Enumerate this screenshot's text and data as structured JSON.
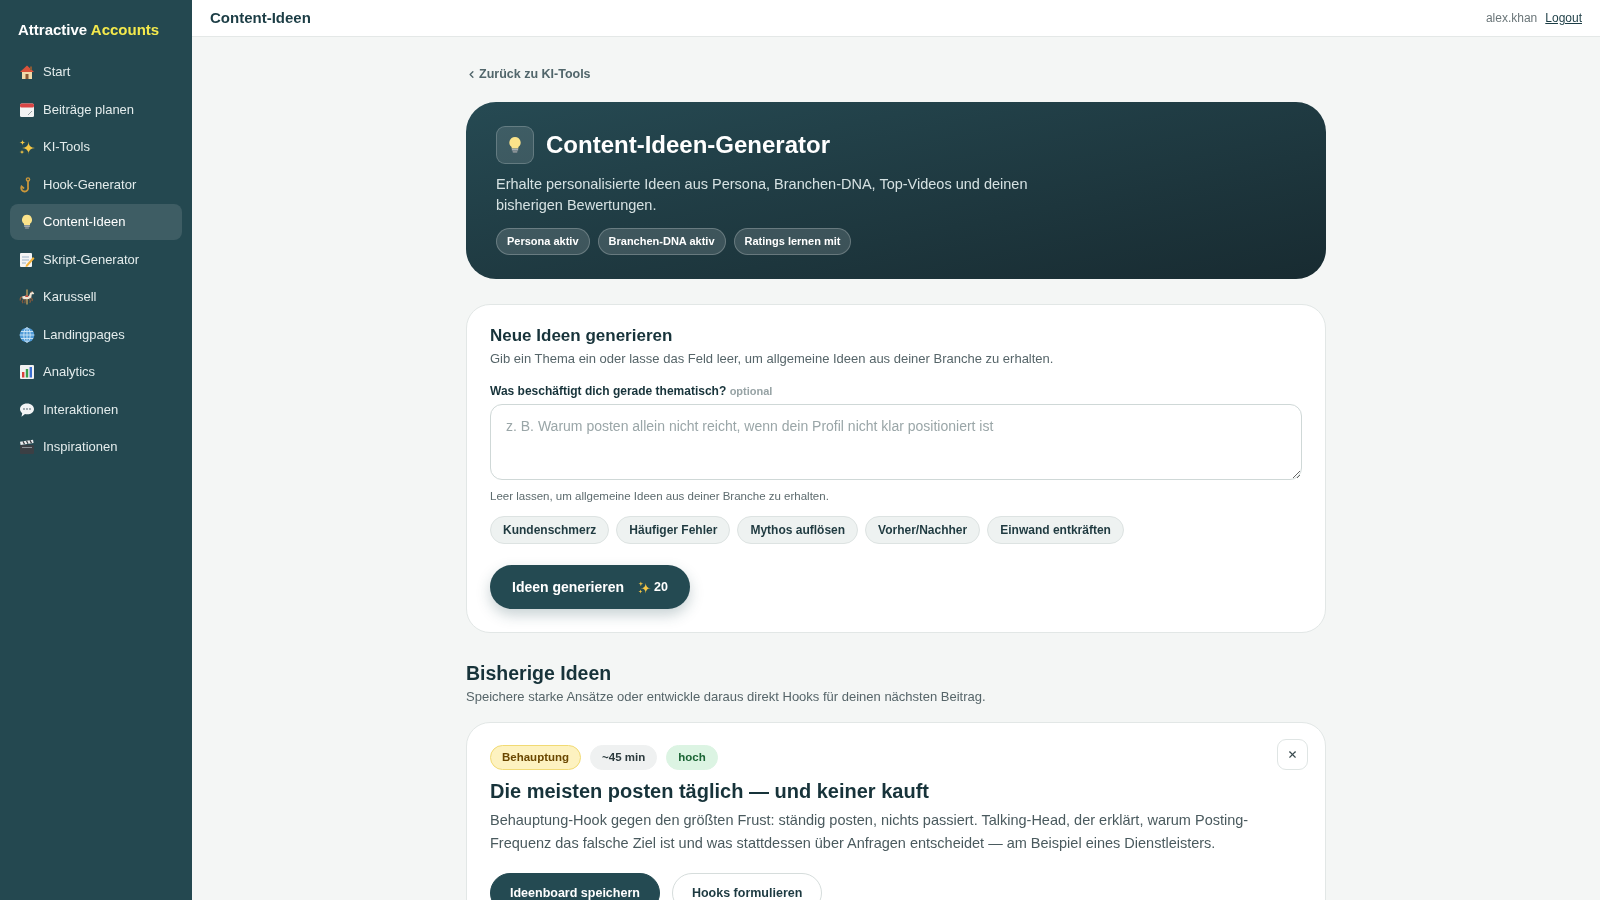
{
  "sidebar": {
    "logo": {
      "text": "Attractive",
      "accent": "Accounts"
    },
    "items": [
      {
        "label": "Start",
        "selected": false
      },
      {
        "label": "Beiträge planen",
        "selected": false
      },
      {
        "label": "KI-Tools",
        "selected": false
      },
      {
        "label": "Hook-Generator",
        "selected": false
      },
      {
        "label": "Content-Ideen",
        "selected": true
      },
      {
        "label": "Skript-Generator",
        "selected": false
      },
      {
        "label": "Karussell",
        "selected": false
      },
      {
        "label": "Landingpages",
        "selected": false
      },
      {
        "label": "Analytics",
        "selected": false
      },
      {
        "label": "Interaktionen",
        "selected": false
      },
      {
        "label": "Inspirationen",
        "selected": false
      }
    ]
  },
  "header": {
    "title": "Content-Ideen",
    "user": "alex.khan",
    "logout": "Logout"
  },
  "back_link": "Zurück zu KI-Tools",
  "hero": {
    "title": "Content-Ideen-Generator",
    "description": "Erhalte personalisierte Ideen aus Persona, Branchen-DNA, Top-Videos und deinen bisherigen Bewertungen.",
    "tags": [
      "Persona aktiv",
      "Branchen-DNA aktiv",
      "Ratings lernen mit"
    ]
  },
  "generator": {
    "title": "Neue Ideen generieren",
    "description": "Gib ein Thema ein oder lasse das Feld leer, um allgemeine Ideen aus deiner Branche zu erhalten.",
    "field_label": "Was beschäftigt dich gerade thematisch?",
    "field_optional": "optional",
    "placeholder": "z. B. Warum posten allein nicht reicht, wenn dein Profil nicht klar positioniert ist",
    "hint": "Leer lassen, um allgemeine Ideen aus deiner Branche zu erhalten.",
    "suggestions": [
      "Kundenschmerz",
      "Häufiger Fehler",
      "Mythos auflösen",
      "Vorher/Nachher",
      "Einwand entkräften"
    ],
    "submit": {
      "label": "Ideen generieren",
      "credits": "20"
    }
  },
  "history": {
    "title": "Bisherige Ideen",
    "description": "Speichere starke Ansätze oder entwickle daraus direkt Hooks für deinen nächsten Beitrag.",
    "ideas": [
      {
        "badges": [
          {
            "label": "Behauptung",
            "kind": "format"
          },
          {
            "label": "~45 min",
            "kind": "duration"
          },
          {
            "label": "hoch",
            "kind": "potential"
          }
        ],
        "title": "Die meisten posten täglich — und keiner kauft",
        "text": "Behauptung-Hook gegen den größten Frust: ständig posten, nichts passiert. Talking-Head, der erklärt, warum Posting-Frequenz das falsche Ziel ist und was stattdessen über Anfragen entscheidet — am Beispiel eines Dienstleisters.",
        "actions": [
          {
            "label": "Ideenboard speichern",
            "kind": "primary"
          },
          {
            "label": "Hooks formulieren",
            "kind": "secondary"
          }
        ]
      }
    ]
  }
}
